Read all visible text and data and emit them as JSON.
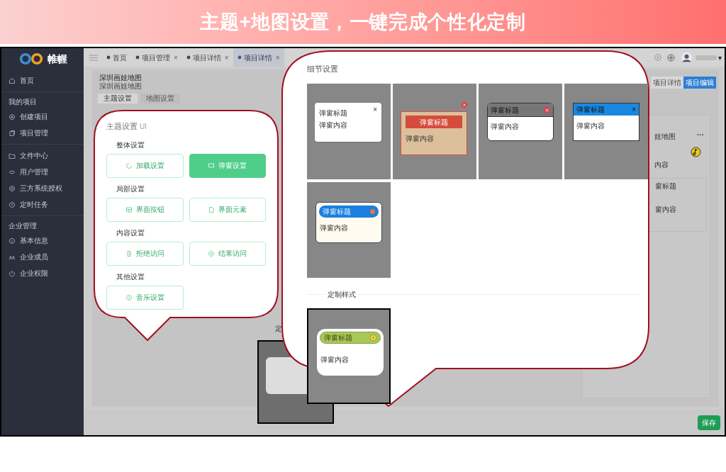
{
  "banner": {
    "title": "主题+地图设置，一键完成个性化定制"
  },
  "sidebar": {
    "logo": "帷幄",
    "sections": [
      {
        "items": [
          {
            "label": "首页"
          }
        ]
      },
      {
        "heading": "我的项目",
        "items": [
          {
            "label": "创建项目"
          },
          {
            "label": "项目管理"
          }
        ]
      },
      {
        "items": [
          {
            "label": "文件中心"
          },
          {
            "label": "用户管理"
          },
          {
            "label": "三方系统授权"
          },
          {
            "label": "定时任务"
          }
        ]
      },
      {
        "heading": "企业管理",
        "items": [
          {
            "label": "基本信息"
          },
          {
            "label": "企业成员"
          },
          {
            "label": "企业权限"
          }
        ]
      }
    ]
  },
  "tabs": [
    {
      "label": "首页",
      "selected": false
    },
    {
      "label": "项目管理",
      "close": "×",
      "selected": false
    },
    {
      "label": "项目详情",
      "close": "×",
      "selected": false
    },
    {
      "label": "项目详情",
      "close": "×",
      "selected": true
    }
  ],
  "user_menu_caret": "▾",
  "header": {
    "title": "深圳画娃地图",
    "subtitle": "深圳画娃地图",
    "view_buttons": [
      {
        "label": "项目详情",
        "selected": false
      },
      {
        "label": "项目编辑",
        "selected": true
      }
    ],
    "settings_tabs": [
      {
        "label": "主题设置",
        "selected": true
      },
      {
        "label": "地图设置",
        "selected": false
      }
    ]
  },
  "right_panel": {
    "title": "娃地图",
    "more": "···",
    "lines": [
      "内容",
      "窗标题",
      "窗内容"
    ]
  },
  "theme_bubble": {
    "title": "主题设置",
    "suffix": "UI",
    "groups": [
      {
        "heading": "整体设置",
        "options": [
          {
            "label": "加载设置",
            "selected": false
          },
          {
            "label": "弹窗设置",
            "selected": true
          }
        ]
      },
      {
        "heading": "局部设置",
        "options": [
          {
            "label": "界面按钮",
            "selected": false
          },
          {
            "label": "界面元素",
            "selected": false
          }
        ]
      },
      {
        "heading": "内容设置",
        "options": [
          {
            "label": "拒绝访问",
            "selected": false
          },
          {
            "label": "结果访问",
            "selected": false
          }
        ]
      },
      {
        "heading": "其他设置",
        "options": [
          {
            "label": "音乐设置",
            "selected": false
          }
        ]
      }
    ]
  },
  "background_heading": "定",
  "detail_bubble": {
    "title": "细节设置",
    "presets": [
      {
        "kind": "plain",
        "title": "弹窗标题",
        "content": "弹窗内容",
        "close": "×"
      },
      {
        "kind": "banner",
        "title": "弹窗标题",
        "content": "弹窗内容"
      },
      {
        "kind": "grey",
        "title": "弹窗标题",
        "content": "弹窗内容"
      },
      {
        "kind": "blue",
        "title": "弹窗标题",
        "content": "弹窗内容",
        "close": "×"
      },
      {
        "kind": "pill",
        "title": "弹窗标题",
        "content": "弹窗内容"
      }
    ],
    "custom_heading": "定制样式",
    "custom": [
      {
        "kind": "green",
        "title": "弹窗标题",
        "content": "弹窗内容"
      }
    ]
  },
  "save_button": "保存"
}
